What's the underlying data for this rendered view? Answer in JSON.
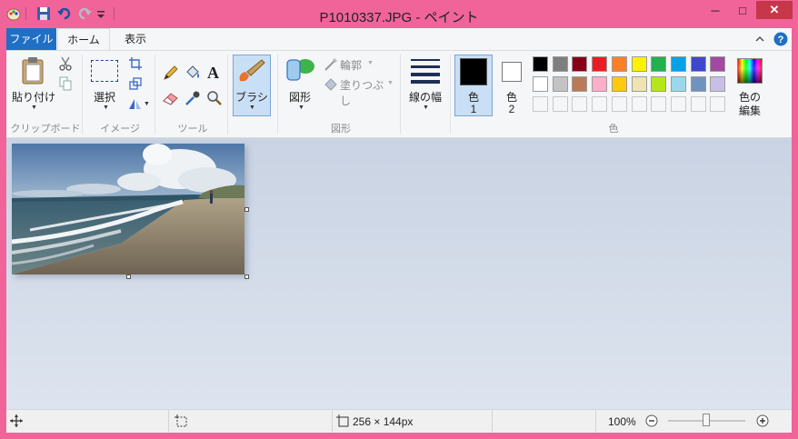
{
  "window": {
    "title": "P1010337.JPG - ペイント",
    "minimize_glyph": "─",
    "maximize_glyph": "□",
    "close_glyph": "✕"
  },
  "tabs": {
    "file": "ファイル",
    "home": "ホーム",
    "view": "表示"
  },
  "clipboard": {
    "paste": "貼り付け",
    "group": "クリップボード"
  },
  "image": {
    "select": "選択",
    "group": "イメージ"
  },
  "tools": {
    "group": "ツール",
    "text_glyph": "A"
  },
  "brush": {
    "label": "ブラシ"
  },
  "shapes": {
    "label": "図形",
    "outline": "輪郭",
    "fill": "塗りつぶし",
    "group": "図形"
  },
  "size": {
    "label": "線の幅"
  },
  "colors": {
    "color1_a": "色",
    "color1_b": "1",
    "color2_a": "色",
    "color2_b": "2",
    "edit_a": "色の",
    "edit_b": "編集",
    "group": "色",
    "color1_value": "#000000",
    "color2_value": "#ffffff",
    "row1": [
      "#000000",
      "#7f7f7f",
      "#880015",
      "#ed1c24",
      "#ff7f27",
      "#fff200",
      "#22b14c",
      "#00a2e8",
      "#3f48cc",
      "#a349a4"
    ],
    "row2": [
      "#ffffff",
      "#c3c3c3",
      "#b97a57",
      "#ffaec9",
      "#ffc90e",
      "#efe4b0",
      "#b5e61d",
      "#99d9ea",
      "#7092be",
      "#c8bfe7"
    ]
  },
  "status": {
    "dimensions": "256 × 144px",
    "zoom": "100%",
    "zoom_level": 1.0
  }
}
